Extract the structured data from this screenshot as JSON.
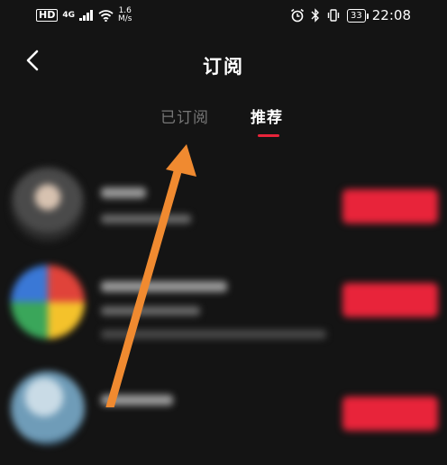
{
  "status_bar": {
    "hd": "HD",
    "network": "4G",
    "speed_value": "1.6",
    "speed_unit": "M/s",
    "battery": "33",
    "time": "22:08"
  },
  "header": {
    "title": "订阅"
  },
  "tabs": [
    {
      "label": "已订阅",
      "active": false
    },
    {
      "label": "推荐",
      "active": true
    }
  ],
  "colors": {
    "accent": "#e8243a",
    "background": "#141414",
    "arrow": "#f08a30"
  }
}
